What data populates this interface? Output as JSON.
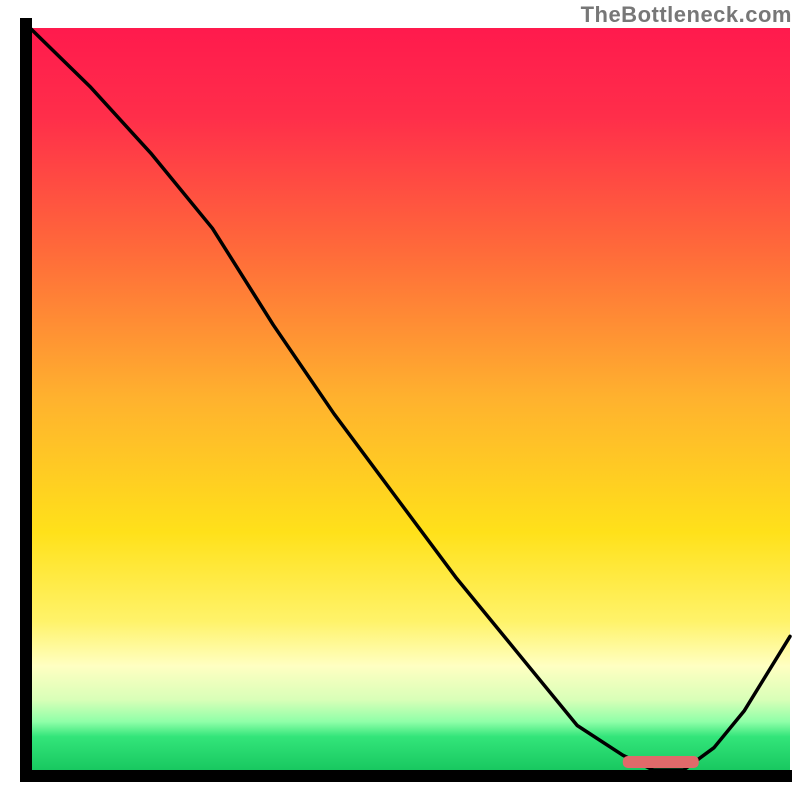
{
  "watermark": "TheBottleneck.com",
  "chart_data": {
    "type": "line",
    "title": "",
    "xlabel": "",
    "ylabel": "",
    "xlim": [
      0,
      100
    ],
    "ylim": [
      0,
      100
    ],
    "series": [
      {
        "name": "curve",
        "x": [
          0,
          8,
          16,
          24,
          32,
          40,
          48,
          56,
          64,
          72,
          78,
          82,
          86,
          90,
          94,
          100
        ],
        "y": [
          100,
          92,
          83,
          73,
          60,
          48,
          37,
          26,
          16,
          6,
          2,
          0,
          0,
          3,
          8,
          18
        ]
      }
    ],
    "valley_marker": {
      "x_start": 78,
      "x_end": 88,
      "color": "#e06a6a"
    },
    "gradient_zones": [
      {
        "pct": 0,
        "color": "#ff1a4d"
      },
      {
        "pct": 50,
        "color": "#ffb22e"
      },
      {
        "pct": 80,
        "color": "#fff36a"
      },
      {
        "pct": 95,
        "color": "#33e57a"
      },
      {
        "pct": 100,
        "color": "#18c860"
      }
    ]
  }
}
